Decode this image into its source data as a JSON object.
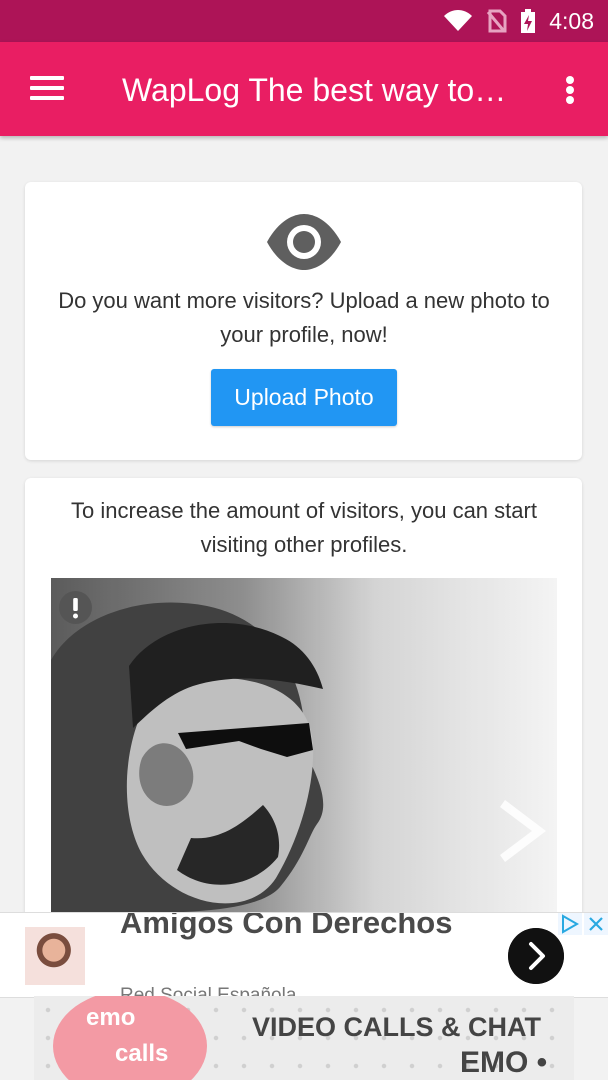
{
  "status_bar": {
    "time": "4:08",
    "icons": [
      "wifi-icon",
      "no-sim-icon",
      "battery-charging-icon"
    ]
  },
  "app_bar": {
    "title": "WapLog The best way to…",
    "menu_icon": "hamburger-menu-icon",
    "overflow_icon": "more-vertical-icon"
  },
  "visitor_card": {
    "icon": "eye-icon",
    "message": "Do you want more visitors? Upload a new photo to your profile, now!",
    "upload_button": "Upload Photo"
  },
  "profiles_card": {
    "message": "To increase the amount of visitors, you can start visiting other profiles.",
    "photo": {
      "description": "black-and-white profile photo",
      "report_icon": "alert-icon",
      "next_icon": "chevron-right-icon"
    }
  },
  "ad_banner": {
    "title": "Amigos Con Derechos",
    "subtitle": "Red Social Española",
    "thumbnail_icon": "woman-photo-thumbnail",
    "next_button_icon": "arrow-right-circle-icon",
    "adchoices_icon": "adchoices-icon",
    "close_icon": "close-ad-icon"
  },
  "emo_banner": {
    "logo_line1": "emo",
    "logo_line2": "calls",
    "headline": "VIDEO CALLS & CHAT",
    "brand": "EMO •"
  },
  "colors": {
    "status_bar": "#ad1457",
    "app_bar": "#e91e63",
    "button": "#2196f3",
    "background": "#f2f2f2",
    "card": "#ffffff"
  }
}
